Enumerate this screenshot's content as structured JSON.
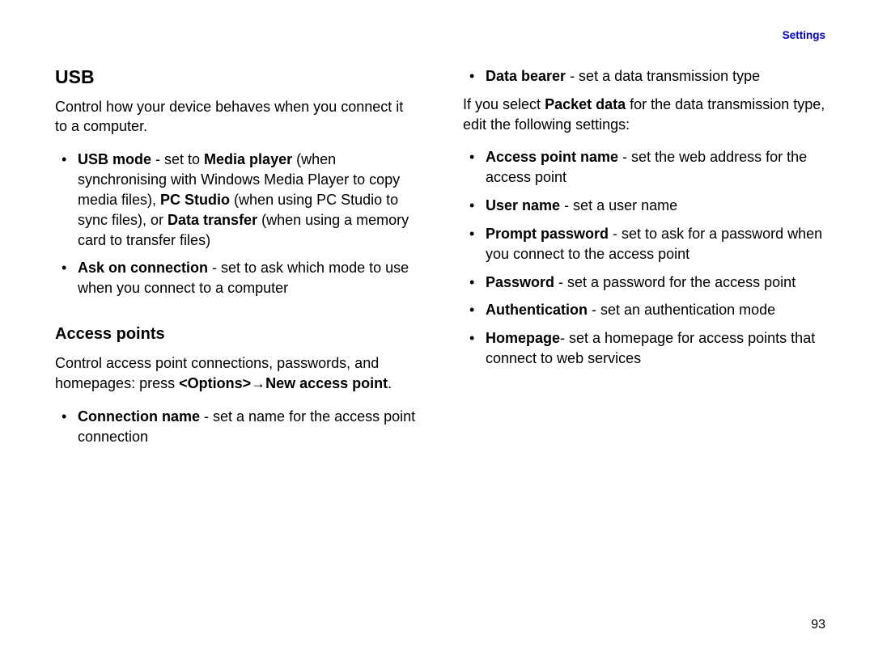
{
  "header": {
    "link": "Settings"
  },
  "left": {
    "heading1": "USB",
    "para1": "Control how your device behaves when you connect it to a computer.",
    "usbItems": [
      {
        "b1": "USB mode",
        "t1": " - set to ",
        "b2": "Media player",
        "t2": " (when synchronising with Windows Media Player to copy media files), ",
        "b3": "PC Studio",
        "t3": " (when using PC Studio to sync files), or ",
        "b4": "Data transfer",
        "t4": " (when using a memory card to transfer files)"
      },
      {
        "b1": "Ask on connection",
        "t1": " - set to ask which mode to use when you connect to a computer"
      }
    ],
    "heading2": "Access points",
    "para2a": "Control access point connections, passwords, and homepages: press ",
    "para2b": "<Options>",
    "arrow": " → ",
    "para2c": "New access point",
    "para2d": ".",
    "apItems": [
      {
        "b1": "Connection name",
        "t1": " - set a name for the access point connection"
      }
    ]
  },
  "right": {
    "topItems": [
      {
        "b1": "Data bearer",
        "t1": " - set a data transmission type"
      }
    ],
    "para1a": "If you select ",
    "para1b": "Packet data",
    "para1c": " for the data transmission type, edit the following settings:",
    "items": [
      {
        "b1": "Access point name",
        "t1": " - set the web address for the access point"
      },
      {
        "b1": "User name",
        "t1": " - set a user name"
      },
      {
        "b1": "Prompt password",
        "t1": " - set to ask for a password when you connect to the access point"
      },
      {
        "b1": "Password",
        "t1": " - set a password for the access point"
      },
      {
        "b1": "Authentication",
        "t1": " - set an authentication mode"
      },
      {
        "b1": "Homepage",
        "t1": "- set a homepage for access points that connect to web services"
      }
    ]
  },
  "pageNumber": "93"
}
